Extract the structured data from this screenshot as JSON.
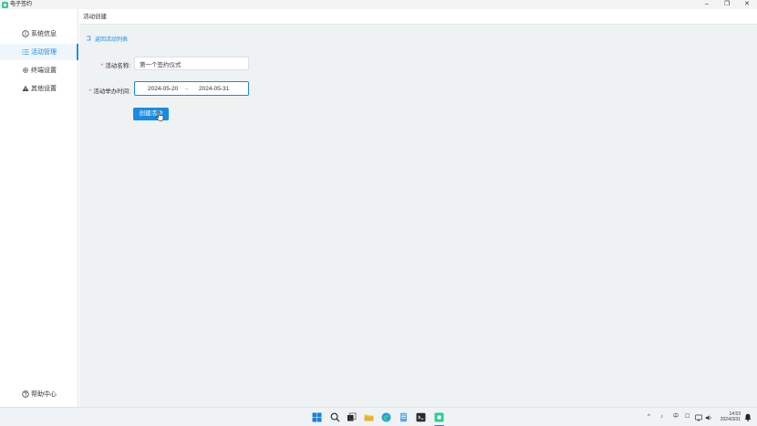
{
  "window": {
    "title": "电子签约",
    "controls": {
      "minimize": "–",
      "maximize": "❐",
      "close": "✕"
    }
  },
  "sidebar": {
    "items": [
      {
        "label": "系统信息",
        "icon": "info-icon",
        "active": false
      },
      {
        "label": "活动管理",
        "icon": "list-icon",
        "active": true
      },
      {
        "label": "终端设置",
        "icon": "gear-icon",
        "active": false
      },
      {
        "label": "其他设置",
        "icon": "warning-icon",
        "active": false
      }
    ],
    "help": {
      "label": "帮助中心",
      "icon": "help-icon"
    }
  },
  "main": {
    "header_title": "活动创建",
    "back_link": "返回活动列表",
    "form": {
      "name_label": "活动名称:",
      "name_value": "第一个签约仪式",
      "time_label": "活动举办时间:",
      "start_date": "2024-05-20",
      "range_separator": "–",
      "end_date": "2024-05-31",
      "submit_label": "创建活动"
    }
  },
  "colors": {
    "accent": "#1a8be0",
    "required": "#e34d4d",
    "main_bg": "#eef2f3",
    "app_logo": "#2ecc8f"
  },
  "taskbar": {
    "icons": [
      "windows-start-icon",
      "search-icon",
      "task-view-icon",
      "file-explorer-icon",
      "edge-browser-icon",
      "notepad-icon",
      "terminal-icon",
      "esign-app-icon"
    ],
    "tray": {
      "chevron": "^",
      "mic": "♪",
      "ime": "中",
      "ime_extra": "☐",
      "time": "14:53",
      "date": "2024/3/31"
    }
  }
}
